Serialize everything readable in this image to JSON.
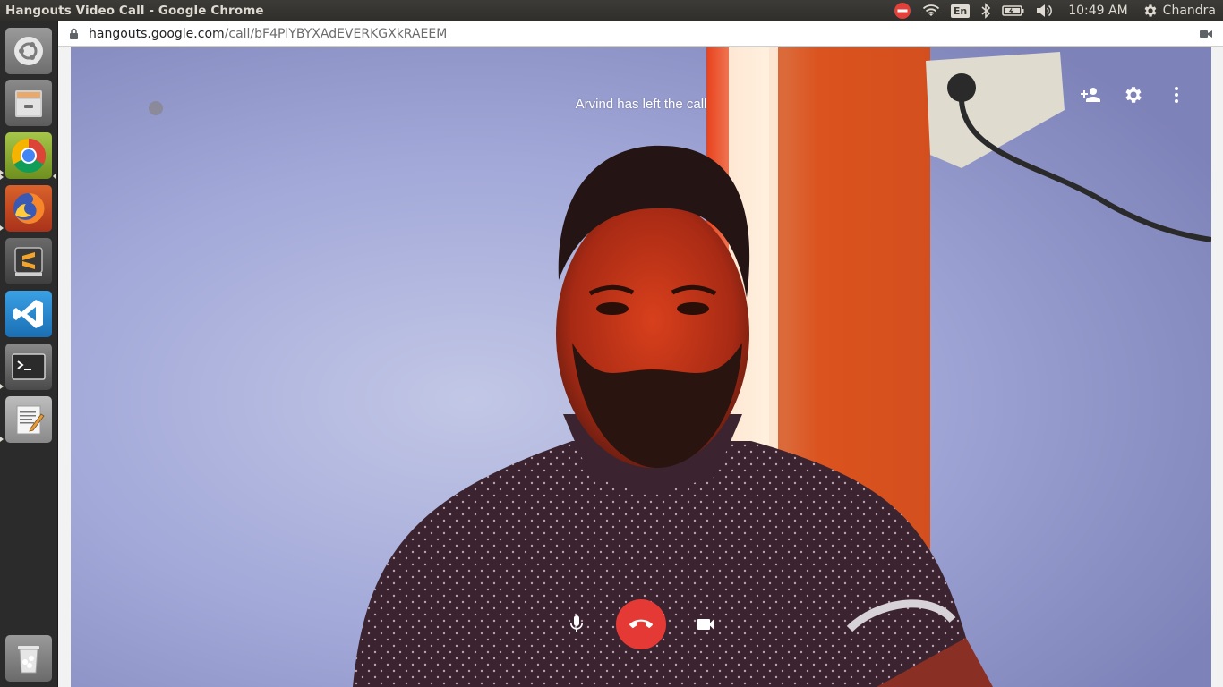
{
  "window": {
    "title": "Hangouts Video Call - Google Chrome"
  },
  "panel": {
    "keyboard_layout": "En",
    "clock": "10:49 AM",
    "user": "Chandra"
  },
  "launcher": {
    "items": [
      "Ubuntu Dash",
      "Files",
      "Google Chrome",
      "Firefox",
      "Sublime Text",
      "Visual Studio Code",
      "Terminal",
      "Text Editor",
      "Trash"
    ]
  },
  "browser": {
    "url_host": "hangouts.google.com",
    "url_path": "/call/bF4PlYBYXAdEVERKGXkRAEEM"
  },
  "call": {
    "notification": "Arvind has left the call",
    "accent_end_call": "#e53935"
  }
}
